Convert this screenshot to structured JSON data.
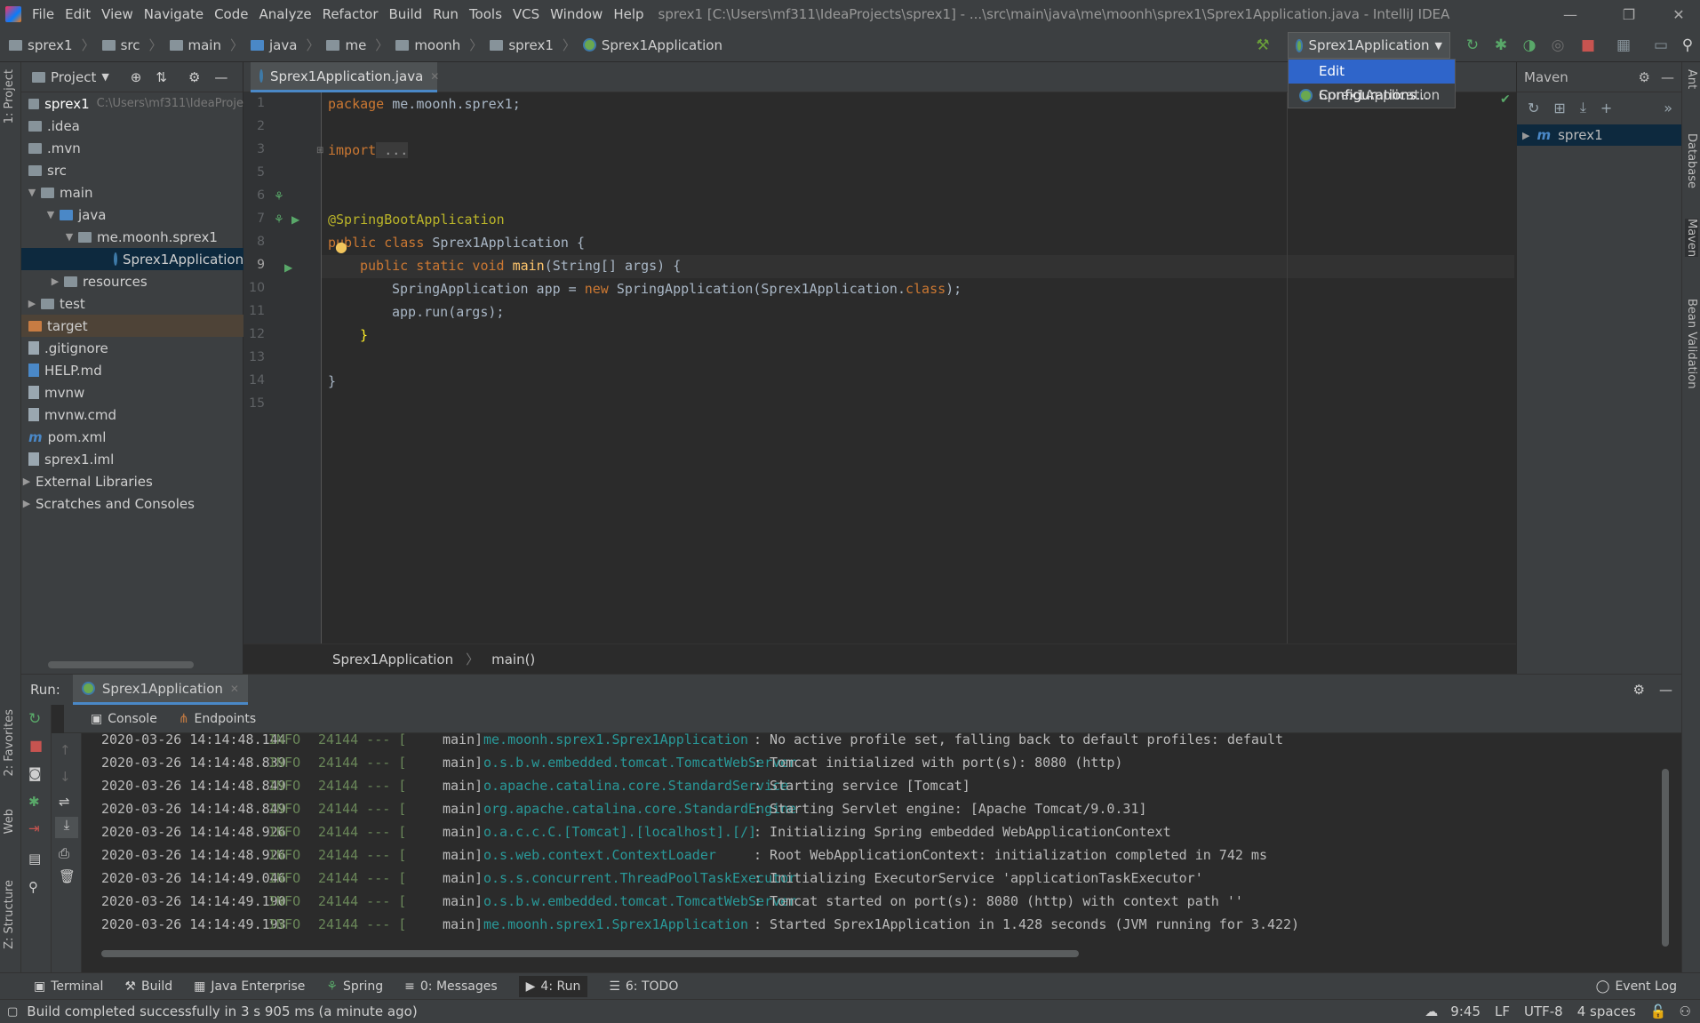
{
  "menubar": {
    "items": [
      "File",
      "Edit",
      "View",
      "Navigate",
      "Code",
      "Analyze",
      "Refactor",
      "Build",
      "Run",
      "Tools",
      "VCS",
      "Window",
      "Help"
    ],
    "title": "sprex1 [C:\\Users\\mf311\\IdeaProjects\\sprex1] - ...\\src\\main\\java\\me\\moonh\\sprex1\\Sprex1Application.java - IntelliJ IDEA"
  },
  "breadcrumb": [
    "sprex1",
    "src",
    "main",
    "java",
    "me",
    "moonh",
    "sprex1",
    "Sprex1Application"
  ],
  "run_config": {
    "selected": "Sprex1Application",
    "dropdown": [
      "Edit Configurations...",
      "Sprex1Application"
    ]
  },
  "left_stripe": {
    "project": "1: Project",
    "favorites": "2: Favorites",
    "web": "Web",
    "structure": "Z: Structure"
  },
  "right_stripe": {
    "ant": "Ant",
    "database": "Database",
    "maven": "Maven",
    "bean": "Bean Validation"
  },
  "project": {
    "header": "Project",
    "root_name": "sprex1",
    "root_path": "C:\\Users\\mf311\\IdeaProje",
    "items": {
      "idea": ".idea",
      "mvn": ".mvn",
      "src": "src",
      "main": "main",
      "java": "java",
      "pkg": "me.moonh.sprex1",
      "app": "Sprex1Application",
      "resources": "resources",
      "test": "test",
      "target": "target",
      "gitignore": ".gitignore",
      "help": "HELP.md",
      "mvnw": "mvnw",
      "mvnwcmd": "mvnw.cmd",
      "pom": "pom.xml",
      "iml": "sprex1.iml",
      "ext": "External Libraries",
      "scratches": "Scratches and Consoles"
    }
  },
  "editor": {
    "tab": "Sprex1Application.java",
    "line_numbers": [
      "1",
      "2",
      "3",
      "5",
      "6",
      "7",
      "8",
      "9",
      "10",
      "11",
      "12",
      "13",
      "14",
      "15"
    ],
    "code": {
      "l1_kw": "package",
      "l1_rest": " me.moonh.sprex1;",
      "l3_kw": "import",
      "l3_rest": " ...",
      "l6": "@SpringBootApplication",
      "l7_kw": "public class",
      "l7_rest": " Sprex1Application {",
      "l9_kw": "public static void",
      "l9_fn": " main",
      "l9_rest": "(String[] args) {",
      "l10_a": "SpringApplication app = ",
      "l10_kw": "new",
      "l10_b": " SpringApplication(Sprex1Application.",
      "l10_kw2": "class",
      "l10_c": ");",
      "l11": "app.run(args);",
      "l12": "}",
      "l14": "}"
    },
    "crumbs": [
      "Sprex1Application",
      "main()"
    ]
  },
  "maven": {
    "title": "Maven",
    "root": "sprex1"
  },
  "run": {
    "label": "Run:",
    "tab": "Sprex1Application",
    "subtabs": [
      "Console",
      "Endpoints"
    ],
    "log": [
      {
        "ts": "2020-03-26 14:14:48.144",
        "lvl": "INFO",
        "pid": "24144 --- [",
        "th": "main]",
        "cls": "me.moonh.sprex1.Sprex1Application",
        "msg": ": No active profile set, falling back to default profiles: default"
      },
      {
        "ts": "2020-03-26 14:14:48.839",
        "lvl": "INFO",
        "pid": "24144 --- [",
        "th": "main]",
        "cls": "o.s.b.w.embedded.tomcat.TomcatWebServer",
        "msg": ": Tomcat initialized with port(s): 8080 (http)"
      },
      {
        "ts": "2020-03-26 14:14:48.849",
        "lvl": "INFO",
        "pid": "24144 --- [",
        "th": "main]",
        "cls": "o.apache.catalina.core.StandardService",
        "msg": ": Starting service [Tomcat]"
      },
      {
        "ts": "2020-03-26 14:14:48.849",
        "lvl": "INFO",
        "pid": "24144 --- [",
        "th": "main]",
        "cls": "org.apache.catalina.core.StandardEngine",
        "msg": ": Starting Servlet engine: [Apache Tomcat/9.0.31]"
      },
      {
        "ts": "2020-03-26 14:14:48.926",
        "lvl": "INFO",
        "pid": "24144 --- [",
        "th": "main]",
        "cls": "o.a.c.c.C.[Tomcat].[localhost].[/]",
        "msg": ": Initializing Spring embedded WebApplicationContext"
      },
      {
        "ts": "2020-03-26 14:14:48.926",
        "lvl": "INFO",
        "pid": "24144 --- [",
        "th": "main]",
        "cls": "o.s.web.context.ContextLoader",
        "msg": ": Root WebApplicationContext: initialization completed in 742 ms"
      },
      {
        "ts": "2020-03-26 14:14:49.046",
        "lvl": "INFO",
        "pid": "24144 --- [",
        "th": "main]",
        "cls": "o.s.s.concurrent.ThreadPoolTaskExecutor",
        "msg": ": Initializing ExecutorService 'applicationTaskExecutor'"
      },
      {
        "ts": "2020-03-26 14:14:49.190",
        "lvl": "INFO",
        "pid": "24144 --- [",
        "th": "main]",
        "cls": "o.s.b.w.embedded.tomcat.TomcatWebServer",
        "msg": ": Tomcat started on port(s): 8080 (http) with context path ''"
      },
      {
        "ts": "2020-03-26 14:14:49.193",
        "lvl": "INFO",
        "pid": "24144 --- [",
        "th": "main]",
        "cls": "me.moonh.sprex1.Sprex1Application",
        "msg": ": Started Sprex1Application in 1.428 seconds (JVM running for 3.422)"
      }
    ]
  },
  "toolbar_bottom": [
    "Terminal",
    "Build",
    "Java Enterprise",
    "Spring",
    "0: Messages",
    "4: Run",
    "6: TODO",
    "Event Log"
  ],
  "status": {
    "message": "Build completed successfully in 3 s 905 ms (a minute ago)",
    "position": "9:45",
    "line_sep": "LF",
    "encoding": "UTF-8",
    "indent": "4 spaces"
  }
}
